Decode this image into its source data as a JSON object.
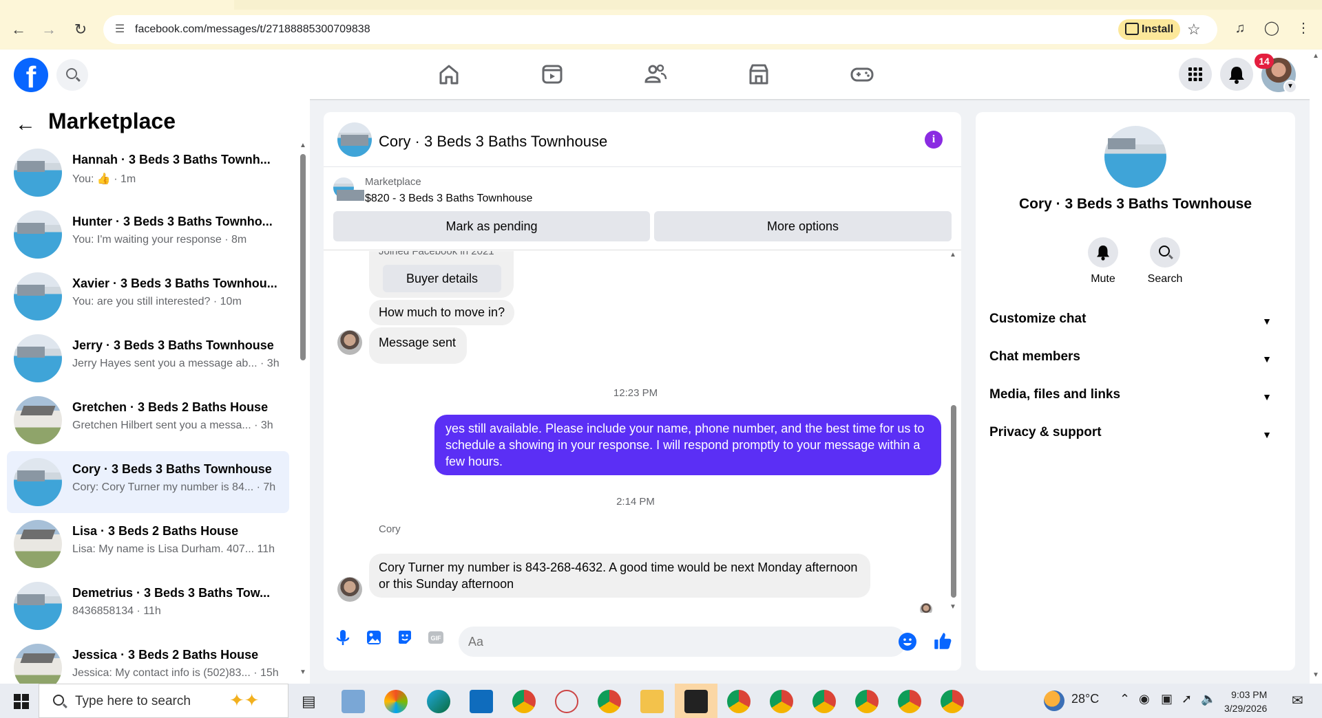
{
  "browser": {
    "url": "facebook.com/messages/t/27188885300709838",
    "install_label": "Install"
  },
  "header": {
    "notification_count": "14",
    "logo_letter": "f"
  },
  "sidebar": {
    "title": "Marketplace",
    "conversations": [
      {
        "name": "Hannah · 3 Beds 3 Baths Townh...",
        "preview": "You: 👍 · 1m",
        "thumb": "pool",
        "active": false
      },
      {
        "name": "Hunter · 3 Beds 3 Baths Townho...",
        "preview": "You: I'm waiting your response · 8m",
        "thumb": "pool",
        "active": false
      },
      {
        "name": "Xavier · 3 Beds 3 Baths Townhou...",
        "preview": "You: are you still interested? · 10m",
        "thumb": "pool",
        "active": false
      },
      {
        "name": "Jerry · 3 Beds 3 Baths Townhouse",
        "preview": "Jerry Hayes sent you a message ab... · 3h",
        "thumb": "pool",
        "active": false
      },
      {
        "name": "Gretchen · 3 Beds 2 Baths House",
        "preview": "Gretchen Hilbert sent you a messa... · 3h",
        "thumb": "house",
        "active": false
      },
      {
        "name": "Cory · 3 Beds 3 Baths Townhouse",
        "preview": "Cory: Cory Turner my number is 84... · 7h",
        "thumb": "pool",
        "active": true
      },
      {
        "name": "Lisa · 3 Beds 2 Baths House",
        "preview": "Lisa: My name is Lisa Durham. 407... 11h",
        "thumb": "house",
        "active": false
      },
      {
        "name": "Demetrius · 3 Beds 3 Baths Tow...",
        "preview": "8436858134 · 11h",
        "thumb": "pool",
        "active": false
      },
      {
        "name": "Jessica · 3 Beds 2 Baths House",
        "preview": "Jessica: My contact info is (502)83... · 15h",
        "thumb": "house",
        "active": false
      }
    ]
  },
  "chat": {
    "title": "Cory · 3 Beds 3 Baths Townhouse",
    "listing_category": "Marketplace",
    "listing_desc": "$820 - 3 Beds 3 Baths Townhouse",
    "mark_pending_label": "Mark as pending",
    "more_options_label": "More options",
    "joined_text": "Joined Facebook in 2021",
    "buyer_details_label": "Buyer details",
    "msg_how_much": "How much to move in?",
    "msg_sent": "Message sent",
    "time_1": "12:23 PM",
    "msg_out": "yes still available.  Please include your name, phone number, and the best time for us to schedule a showing in your response. I will respond promptly to your message within a few hours.",
    "time_2": "2:14 PM",
    "sender_name": "Cory",
    "msg_cory": "Cory Turner my number is 843-268-4632. A good time would be next Monday afternoon or this Sunday afternoon",
    "input_placeholder": "Aa"
  },
  "details": {
    "name": "Cory · 3 Beds 3 Baths Townhouse",
    "mute_label": "Mute",
    "search_label": "Search",
    "rows": [
      "Customize chat",
      "Chat members",
      "Media, files and links",
      "Privacy & support"
    ]
  },
  "taskbar": {
    "search_placeholder": "Type here to search",
    "temperature": "28°C",
    "time": "9:03 PM",
    "date": "3/29/2026"
  },
  "colors": {
    "fb_blue": "#0866ff",
    "outgoing_bubble": "#5b2ff5",
    "active_conv_bg": "#ebf1fd",
    "badge_red": "#e41e3f"
  }
}
